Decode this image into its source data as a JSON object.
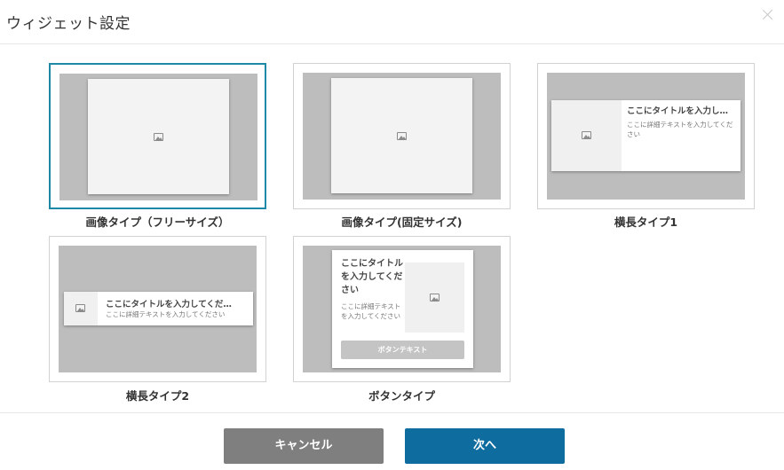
{
  "dialog": {
    "title": "ウィジェット設定"
  },
  "cards": [
    {
      "label": "画像タイプ（フリーサイズ）"
    },
    {
      "label": "画像タイプ(固定サイズ)"
    },
    {
      "label": "横長タイプ1",
      "preview_title": "ここにタイトルを入力し…",
      "preview_desc": "ここに詳細テキストを入力してください"
    },
    {
      "label": "横長タイプ2",
      "preview_title": "ここにタイトルを入力してくだ…",
      "preview_desc": "ここに詳細テキストを入力してください"
    },
    {
      "label": "ボタンタイプ",
      "preview_title": "ここにタイトルを入力してください",
      "preview_desc": "ここに詳細テキストを入力してください",
      "preview_button": "ボタンテキスト"
    }
  ],
  "footer": {
    "cancel_label": "キャンセル",
    "next_label": "次へ"
  },
  "colors": {
    "selected_border": "#1c8aa6",
    "cancel_button": "#7f7f7f",
    "next_button": "#0e6c9e"
  },
  "icons": [
    "close-icon",
    "image-icon"
  ]
}
